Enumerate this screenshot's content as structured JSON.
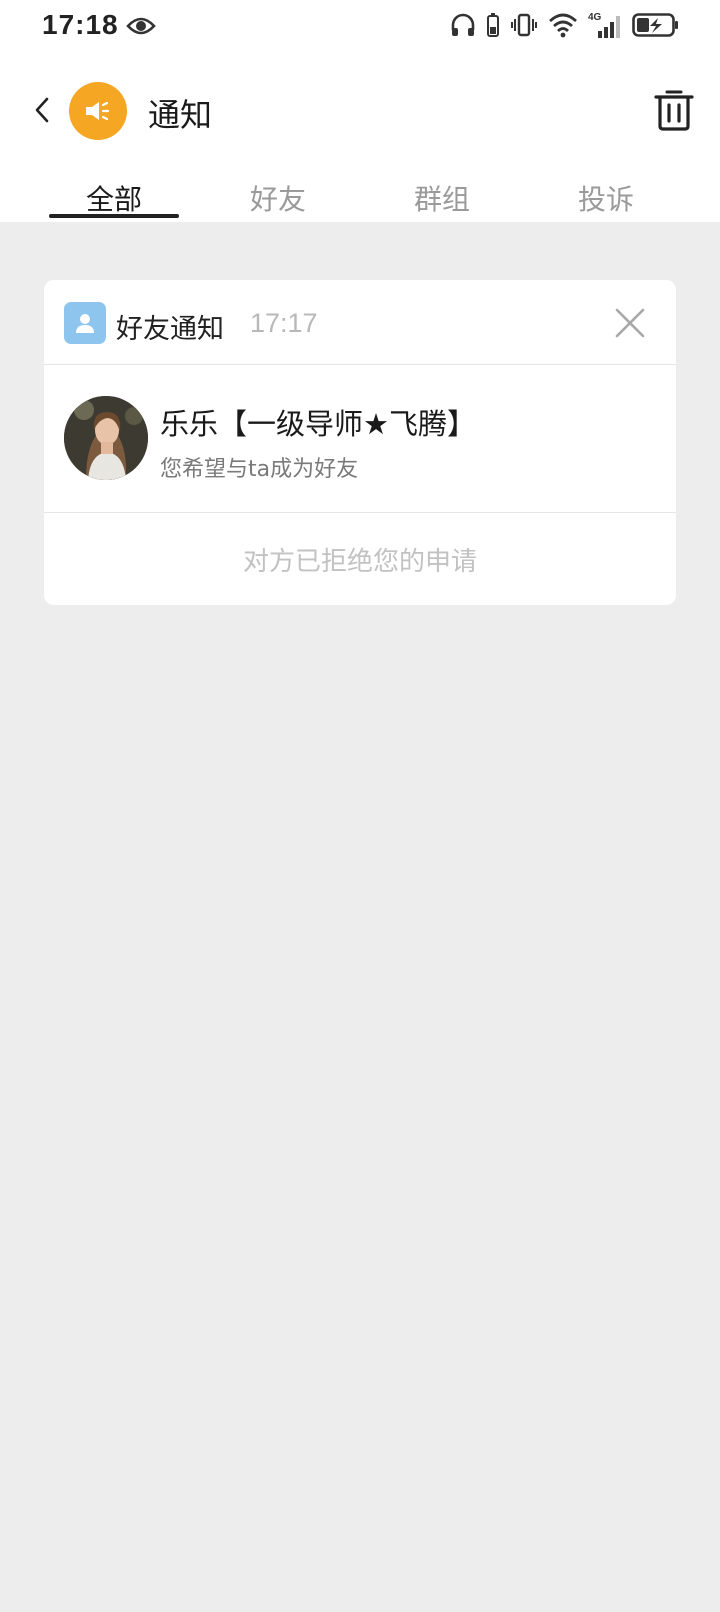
{
  "status_bar": {
    "time": "17:18",
    "network": "4G"
  },
  "header": {
    "title": "通知",
    "accent_color": "#f5a623"
  },
  "tabs": [
    {
      "label": "全部",
      "active": true
    },
    {
      "label": "好友",
      "active": false
    },
    {
      "label": "群组",
      "active": false
    },
    {
      "label": "投诉",
      "active": false
    }
  ],
  "notification": {
    "category": "好友通知",
    "time": "17:17",
    "user_name": "乐乐【一级导师★飞腾】",
    "message": "您希望与ta成为好友",
    "result": "对方已拒绝您的申请"
  }
}
